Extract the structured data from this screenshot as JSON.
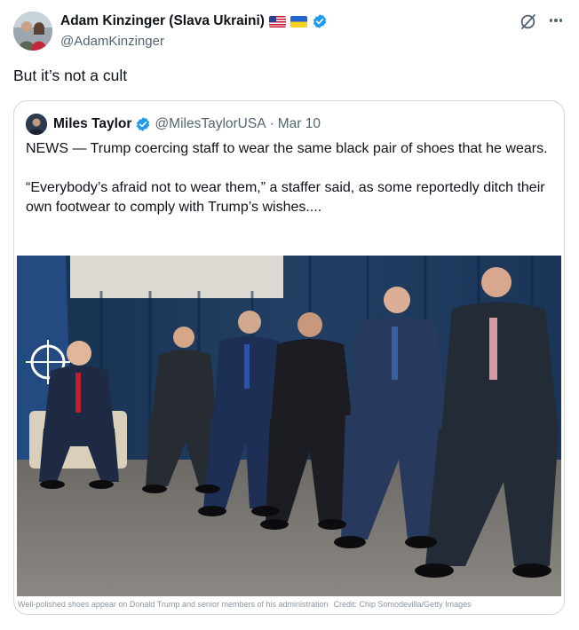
{
  "author": {
    "display_name": "Adam Kinzinger (Slava Ukraini)",
    "handle": "@AdamKinzinger",
    "flags": [
      "us-flag",
      "ukraine-flag"
    ],
    "verified": true
  },
  "post": {
    "text": "But it’s not a cult"
  },
  "quoted": {
    "display_name": "Miles Taylor",
    "handle": "@MilesTaylorUSA",
    "separator": "·",
    "date": "Mar 10",
    "verified": true,
    "paragraphs": [
      "NEWS — Trump coercing staff to wear the same black pair of shoes that he wears.",
      "“Everybody’s afraid not to wear them,” a staffer said, as some reportedly ditch their own footwear to comply with Trump’s wishes...."
    ],
    "media_caption": "Well-polished shoes appear on Donald Trump and senior members of his administration",
    "media_credit": "Credit: Chip Somodevilla/Getty Images"
  },
  "colors": {
    "text": "#0f1419",
    "secondary": "#536471",
    "verified_blue": "#1d9bf0",
    "border": "#cfd9de",
    "curtain": "#1f3a5c"
  }
}
